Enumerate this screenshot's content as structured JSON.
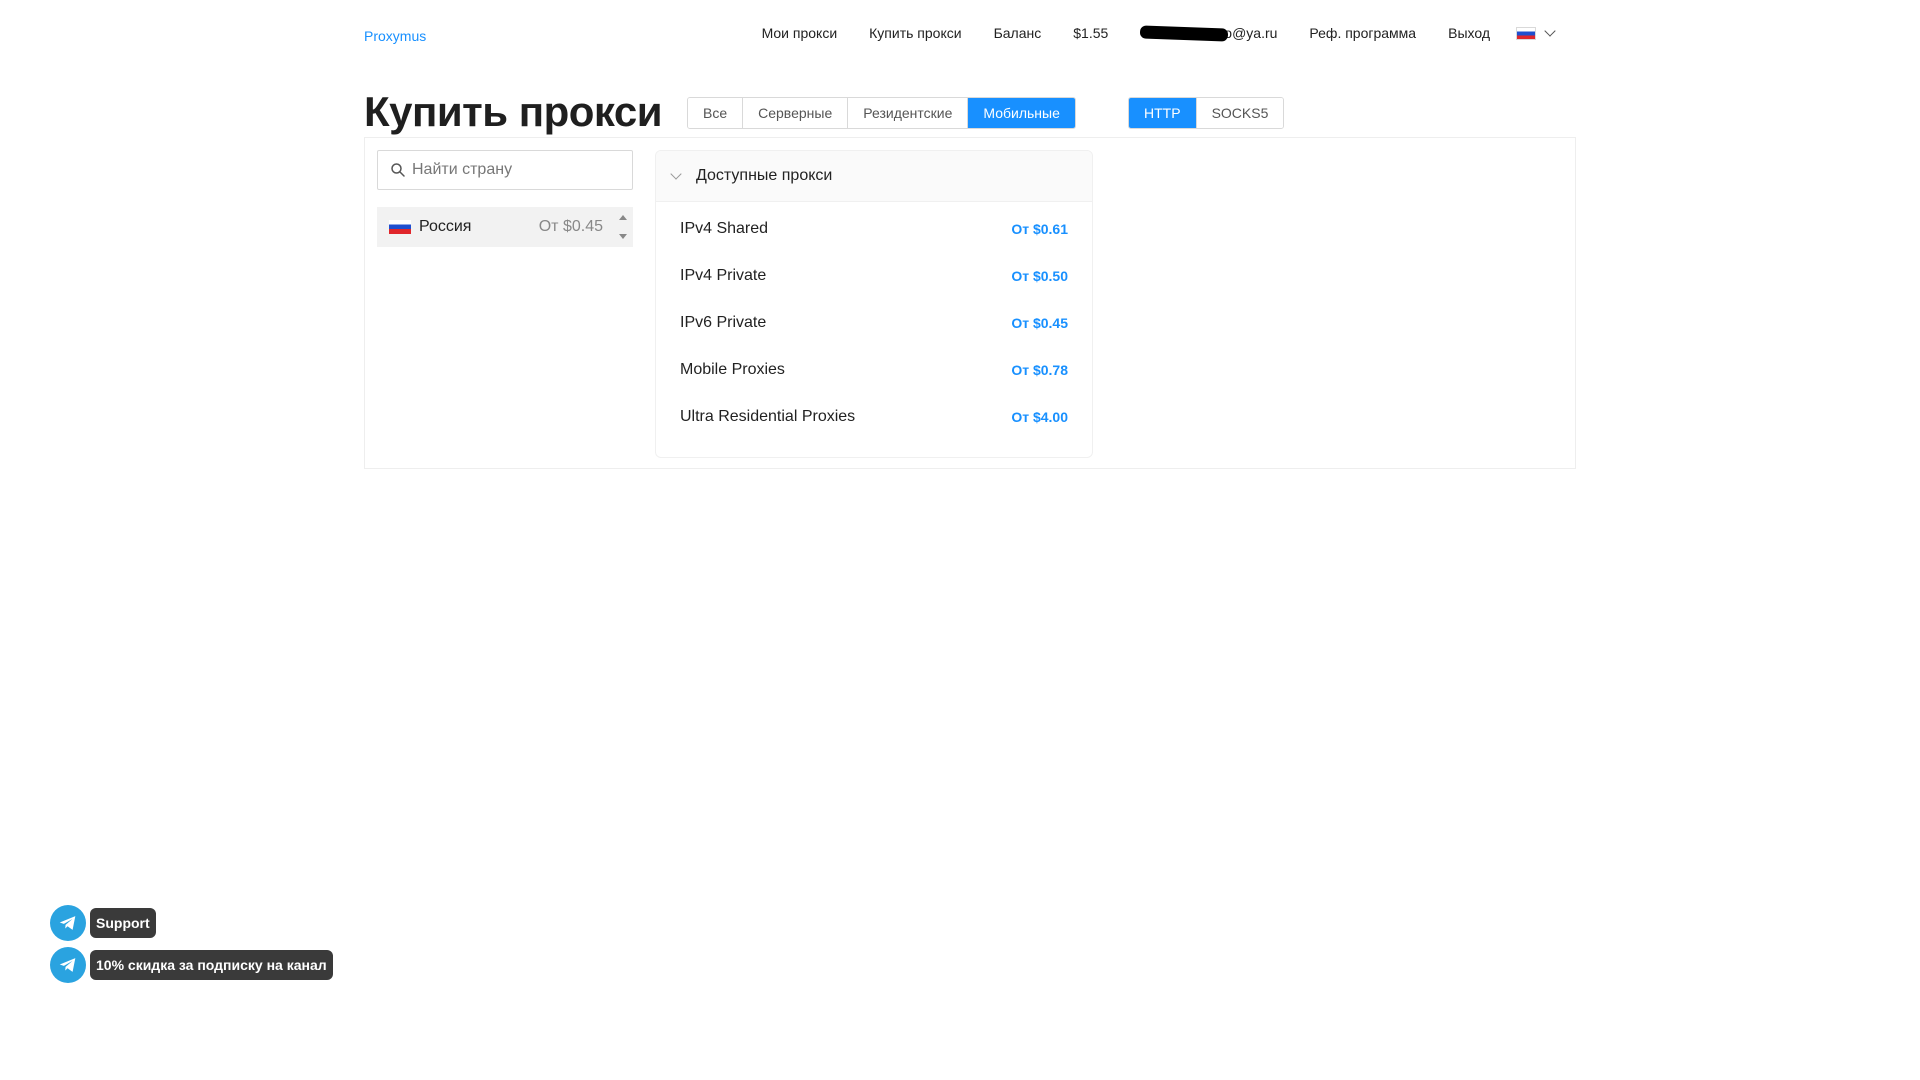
{
  "header": {
    "logo": "Proxymus",
    "nav": {
      "my_proxies": "Мои прокси",
      "buy_proxies": "Купить прокси",
      "balance_label": "Баланс",
      "balance_value": "$1.55",
      "email_visible": "o@ya.ru",
      "referral": "Реф. программа",
      "logout": "Выход"
    },
    "language_flag": "ru-flag-icon"
  },
  "page": {
    "title": "Купить прокси"
  },
  "category_tabs": {
    "items": [
      "Все",
      "Серверные",
      "Резидентские",
      "Мобильные"
    ],
    "active": "Мобильные"
  },
  "protocol_tabs": {
    "items": [
      "HTTP",
      "SOCKS5"
    ],
    "active": "HTTP"
  },
  "search": {
    "placeholder": "Найти страну",
    "value": ""
  },
  "countries": [
    {
      "name": "Россия",
      "price": "От $0.45"
    }
  ],
  "available": {
    "title": "Доступные прокси",
    "items": [
      {
        "name": "IPv4 Shared",
        "price": "От $0.61"
      },
      {
        "name": "IPv4 Private",
        "price": "От $0.50"
      },
      {
        "name": "IPv6 Private",
        "price": "От $0.45"
      },
      {
        "name": "Mobile Proxies",
        "price": "От $0.78"
      },
      {
        "name": "Ultra Residential Proxies",
        "price": "От $4.00"
      }
    ]
  },
  "floating": {
    "support": "Support",
    "channel": "10% скидка за подписку на канал"
  },
  "colors": {
    "accent": "#1890ff",
    "telegram": "#2aa3e0",
    "badge_bg": "#3a3a3a"
  }
}
